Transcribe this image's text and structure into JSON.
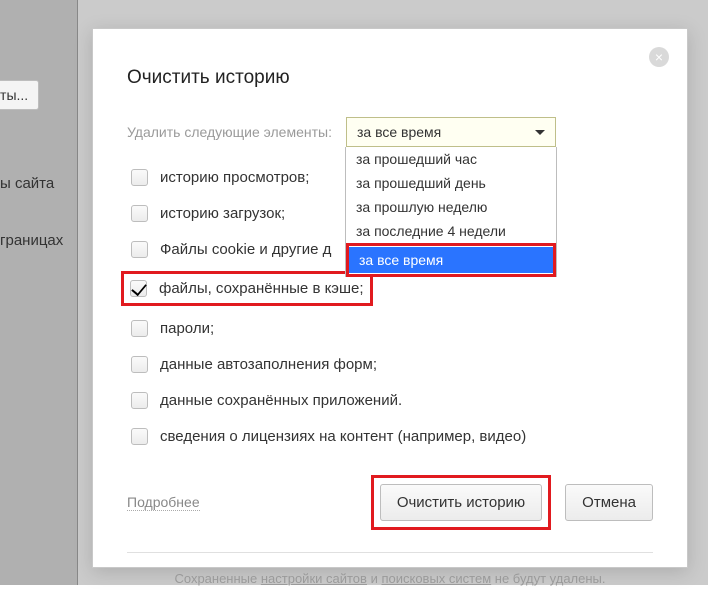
{
  "background": {
    "fonts_button": "ифты...",
    "site_label": "ы сайта",
    "pages_label": "границах"
  },
  "dialog": {
    "title": "Очистить историю",
    "close_glyph": "×",
    "select_label": "Удалить следующие элементы:",
    "select": {
      "value": "за все время",
      "options": [
        "за прошедший час",
        "за прошедший день",
        "за прошлую неделю",
        "за последние 4 недели",
        "за все время"
      ],
      "selected_index": 4
    },
    "items": [
      {
        "label": "историю просмотров;",
        "checked": false
      },
      {
        "label": "историю загрузок;",
        "checked": false
      },
      {
        "label": "Файлы cookie и другие д",
        "checked": false
      },
      {
        "label": "файлы, сохранённые в кэше;",
        "checked": true,
        "highlight": true
      },
      {
        "label": "пароли;",
        "checked": false
      },
      {
        "label": "данные автозаполнения форм;",
        "checked": false
      },
      {
        "label": "данные сохранённых приложений.",
        "checked": false
      },
      {
        "label": "сведения о лицензиях на контент (например, видео)",
        "checked": false
      }
    ],
    "more_link": "Подробнее",
    "clear_button": "Очистить историю",
    "cancel_button": "Отмена",
    "footer_note_pre": "Сохраненные ",
    "footer_note_link1": "настройки сайтов",
    "footer_note_and": " и ",
    "footer_note_link2": "поисковых систем",
    "footer_note_post": " не будут удалены."
  }
}
